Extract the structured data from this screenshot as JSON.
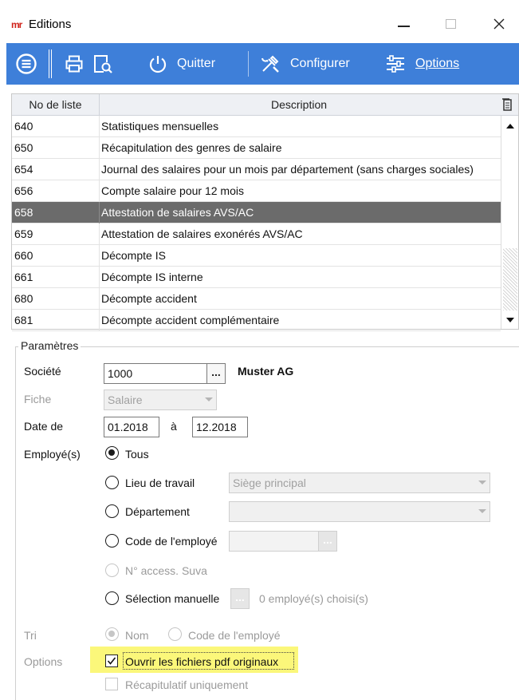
{
  "window": {
    "logo_text": "mr",
    "title": "Editions",
    "min_icon": "minimize-icon",
    "max_icon": "maximize-icon",
    "close_icon": "close-icon"
  },
  "toolbar": {
    "menu_icon": "menu-icon",
    "print_icon": "printer-icon",
    "preview_icon": "print-preview-icon",
    "quit_icon": "power-icon",
    "quit_label": "Quitter",
    "configure_icon": "tools-icon",
    "configure_label": "Configurer",
    "options_icon": "sliders-icon",
    "options_label": "Options",
    "colors": {
      "background": "#3e7fd9",
      "text": "#ffffff"
    }
  },
  "list": {
    "columns": [
      "No de liste",
      "Description"
    ],
    "column_icon": "column-chooser-icon",
    "rows": [
      {
        "no": "640",
        "description": "Statistiques mensuelles",
        "selected": false
      },
      {
        "no": "650",
        "description": "Récapitulation des genres de salaire",
        "selected": false
      },
      {
        "no": "654",
        "description": "Journal des salaires pour un mois par département (sans charges sociales)",
        "selected": false
      },
      {
        "no": "656",
        "description": "Compte salaire pour 12 mois",
        "selected": false
      },
      {
        "no": "658",
        "description": "Attestation de salaires AVS/AC",
        "selected": true
      },
      {
        "no": "659",
        "description": "Attestation de salaires exonérés AVS/AC",
        "selected": false
      },
      {
        "no": "660",
        "description": "Décompte IS",
        "selected": false
      },
      {
        "no": "661",
        "description": "Décompte IS interne",
        "selected": false
      },
      {
        "no": "680",
        "description": "Décompte accident",
        "selected": false
      },
      {
        "no": "681",
        "description": "Décompte accident complémentaire",
        "selected": false
      }
    ],
    "selected_color": "#6b6b6b"
  },
  "params": {
    "group_title": "Paramètres",
    "societe": {
      "label": "Société",
      "value": "1000",
      "button": "...",
      "name": "Muster AG"
    },
    "fiche": {
      "label": "Fiche",
      "value": "Salaire"
    },
    "date": {
      "label": "Date de",
      "from": "01.2018",
      "sep": "à",
      "to": "12.2018"
    },
    "employes": {
      "label": "Employé(s)",
      "tous": "Tous",
      "lieu": "Lieu de travail",
      "lieu_value": "Siège principal",
      "departement": "Département",
      "departement_value": "",
      "code": "Code de l'employé",
      "code_value": "",
      "code_button": "...",
      "suva": "N° access. Suva",
      "selection": "Sélection manuelle",
      "selection_button": "...",
      "selection_info": "0 employé(s) choisi(s)"
    },
    "tri": {
      "label": "Tri",
      "nom": "Nom",
      "code": "Code de l'employé"
    },
    "options": {
      "label": "Options",
      "pdf": "Ouvrir les fichiers pdf originaux",
      "pdf_checked": true,
      "recap": "Récapitulatif uniquement",
      "recap_checked": false,
      "highlight_color": "#fbf77a"
    }
  }
}
